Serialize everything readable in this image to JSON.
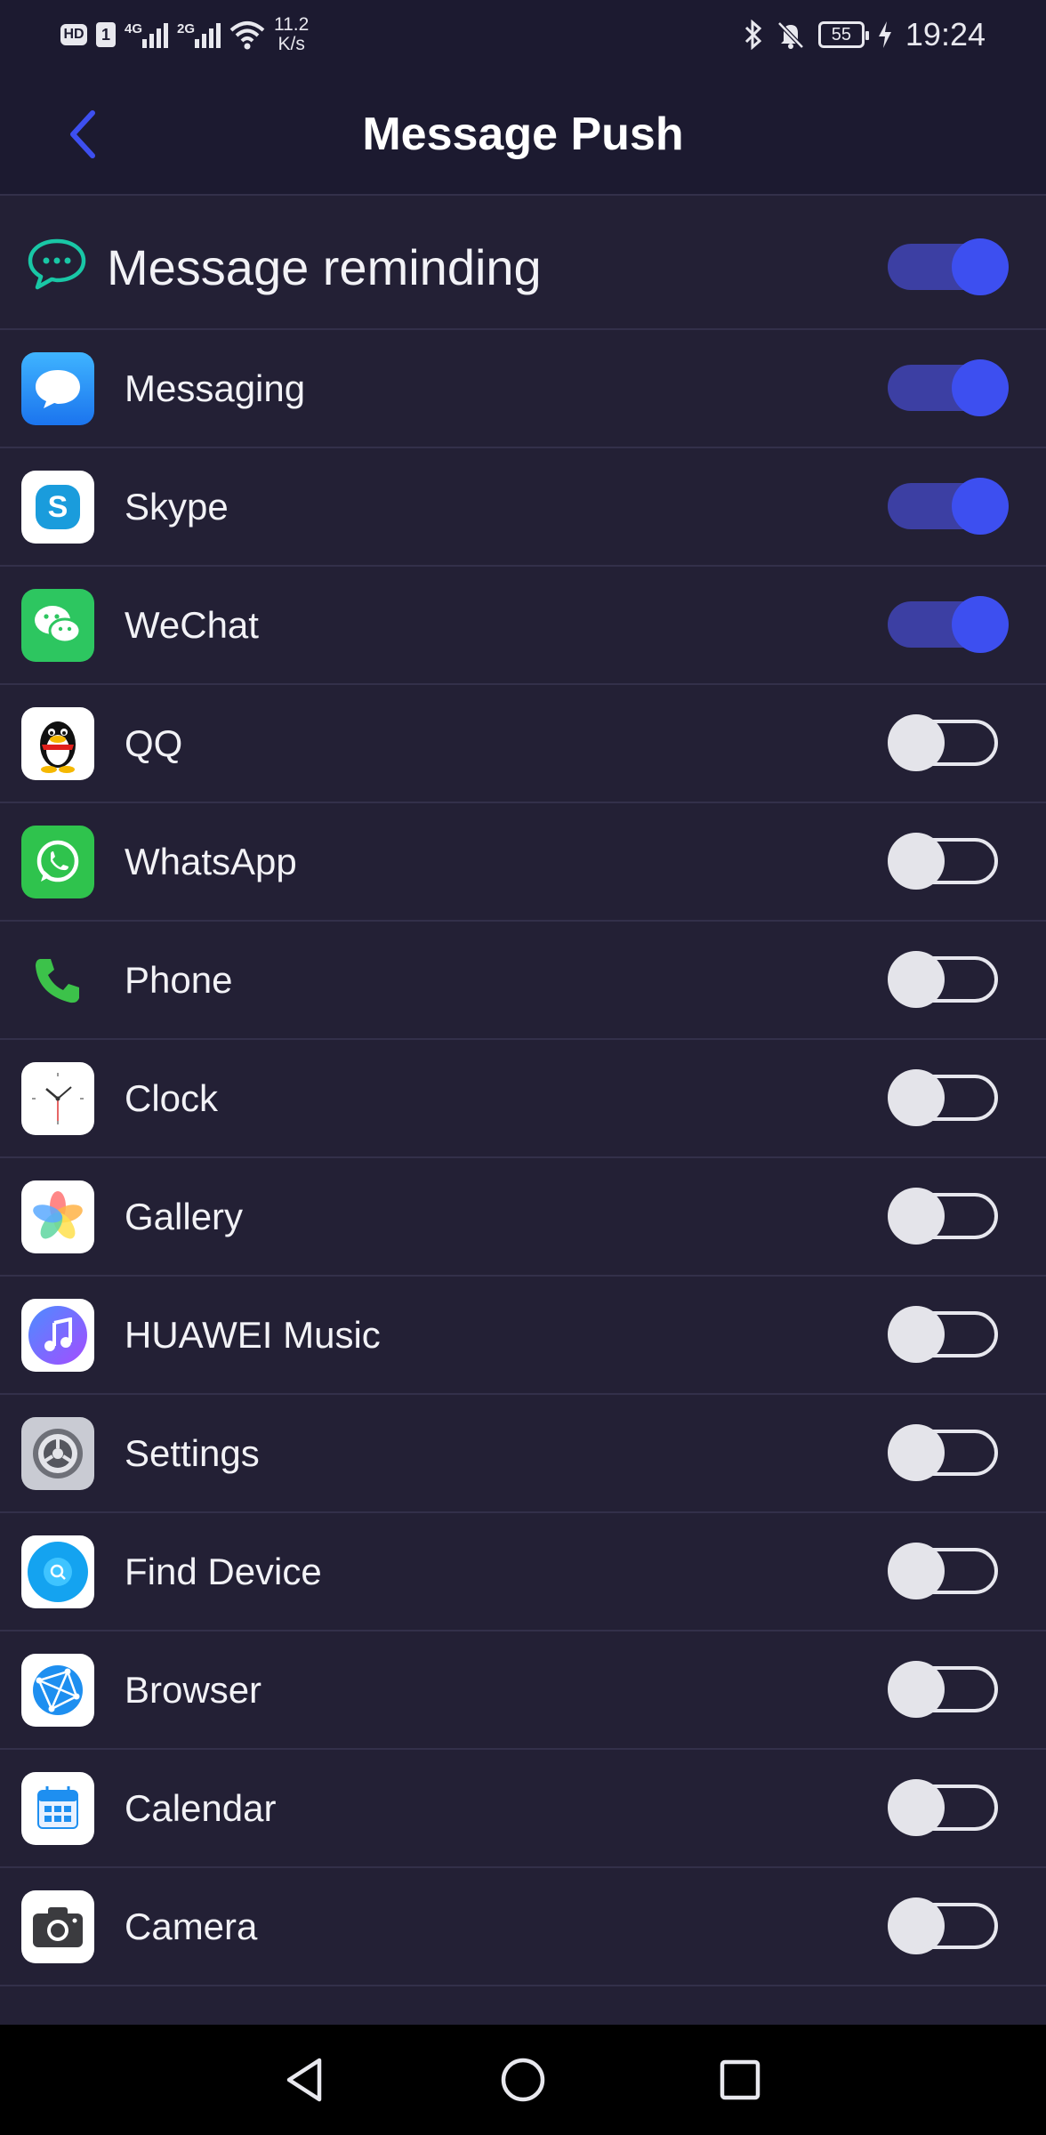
{
  "status_bar": {
    "hd_label": "HD",
    "sim_label": "1",
    "signal1_gen": "4G",
    "signal2_gen": "2G",
    "net_speed_value": "11.2",
    "net_speed_unit": "K/s",
    "battery": "55",
    "time": "19:24"
  },
  "header": {
    "title": "Message Push",
    "accent_color": "#3d4ff0"
  },
  "master": {
    "label": "Message reminding",
    "enabled": true
  },
  "apps": [
    {
      "label": "Messaging",
      "icon": "messaging-icon",
      "enabled": true
    },
    {
      "label": "Skype",
      "icon": "skype-icon",
      "enabled": true
    },
    {
      "label": "WeChat",
      "icon": "wechat-icon",
      "enabled": true
    },
    {
      "label": "QQ",
      "icon": "qq-icon",
      "enabled": false
    },
    {
      "label": "WhatsApp",
      "icon": "whatsapp-icon",
      "enabled": false
    },
    {
      "label": "Phone",
      "icon": "phone-icon",
      "enabled": false
    },
    {
      "label": "Clock",
      "icon": "clock-icon",
      "enabled": false
    },
    {
      "label": "Gallery",
      "icon": "gallery-icon",
      "enabled": false
    },
    {
      "label": "HUAWEI Music",
      "icon": "music-icon",
      "enabled": false
    },
    {
      "label": "Settings",
      "icon": "settings-icon",
      "enabled": false
    },
    {
      "label": "Find Device",
      "icon": "find-device-icon",
      "enabled": false
    },
    {
      "label": "Browser",
      "icon": "browser-icon",
      "enabled": false
    },
    {
      "label": "Calendar",
      "icon": "calendar-icon",
      "enabled": false
    },
    {
      "label": "Camera",
      "icon": "camera-icon",
      "enabled": false
    }
  ]
}
